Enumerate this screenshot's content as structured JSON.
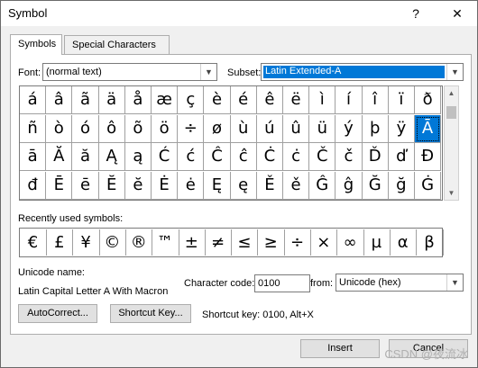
{
  "window": {
    "title": "Symbol",
    "help_label": "?",
    "close_label": "✕"
  },
  "tabs": [
    {
      "label": "Symbols"
    },
    {
      "label": "Special Characters"
    }
  ],
  "font": {
    "label": "Font:",
    "value": "(normal text)"
  },
  "subset": {
    "label": "Subset:",
    "value": "Latin Extended-A"
  },
  "symbol_grid": {
    "rows": [
      [
        "á",
        "â",
        "ã",
        "ä",
        "å",
        "æ",
        "ç",
        "è",
        "é",
        "ê",
        "ë",
        "ì",
        "í",
        "î",
        "ï",
        "ð"
      ],
      [
        "ñ",
        "ò",
        "ó",
        "ô",
        "õ",
        "ö",
        "÷",
        "ø",
        "ù",
        "ú",
        "û",
        "ü",
        "ý",
        "þ",
        "ÿ",
        "Ā"
      ],
      [
        "ā",
        "Ă",
        "ă",
        "Ą",
        "ą",
        "Ć",
        "ć",
        "Ĉ",
        "ĉ",
        "Ċ",
        "ċ",
        "Č",
        "č",
        "Ď",
        "ď",
        "Đ"
      ],
      [
        "đ",
        "Ē",
        "ē",
        "Ĕ",
        "ĕ",
        "Ė",
        "ė",
        "Ę",
        "ę",
        "Ě",
        "ě",
        "Ĝ",
        "ĝ",
        "Ğ",
        "ğ",
        "Ġ"
      ]
    ],
    "selected": "Ā"
  },
  "recent": {
    "label": "Recently used symbols:",
    "symbols": [
      "€",
      "£",
      "¥",
      "©",
      "®",
      "™",
      "±",
      "≠",
      "≤",
      "≥",
      "÷",
      "×",
      "∞",
      "µ",
      "α",
      "β"
    ]
  },
  "unicode_name": {
    "label": "Unicode name:",
    "value": "Latin Capital Letter A With Macron"
  },
  "char_code": {
    "label": "Character code:",
    "value": "0100"
  },
  "from": {
    "label": "from:",
    "value": "Unicode (hex)"
  },
  "buttons": {
    "autocorrect": "AutoCorrect...",
    "shortcut_key": "Shortcut Key...",
    "insert": "Insert",
    "cancel": "Cancel"
  },
  "shortcut_text": "Shortcut key: 0100, Alt+X",
  "watermark": "CSDN @夜流冰"
}
